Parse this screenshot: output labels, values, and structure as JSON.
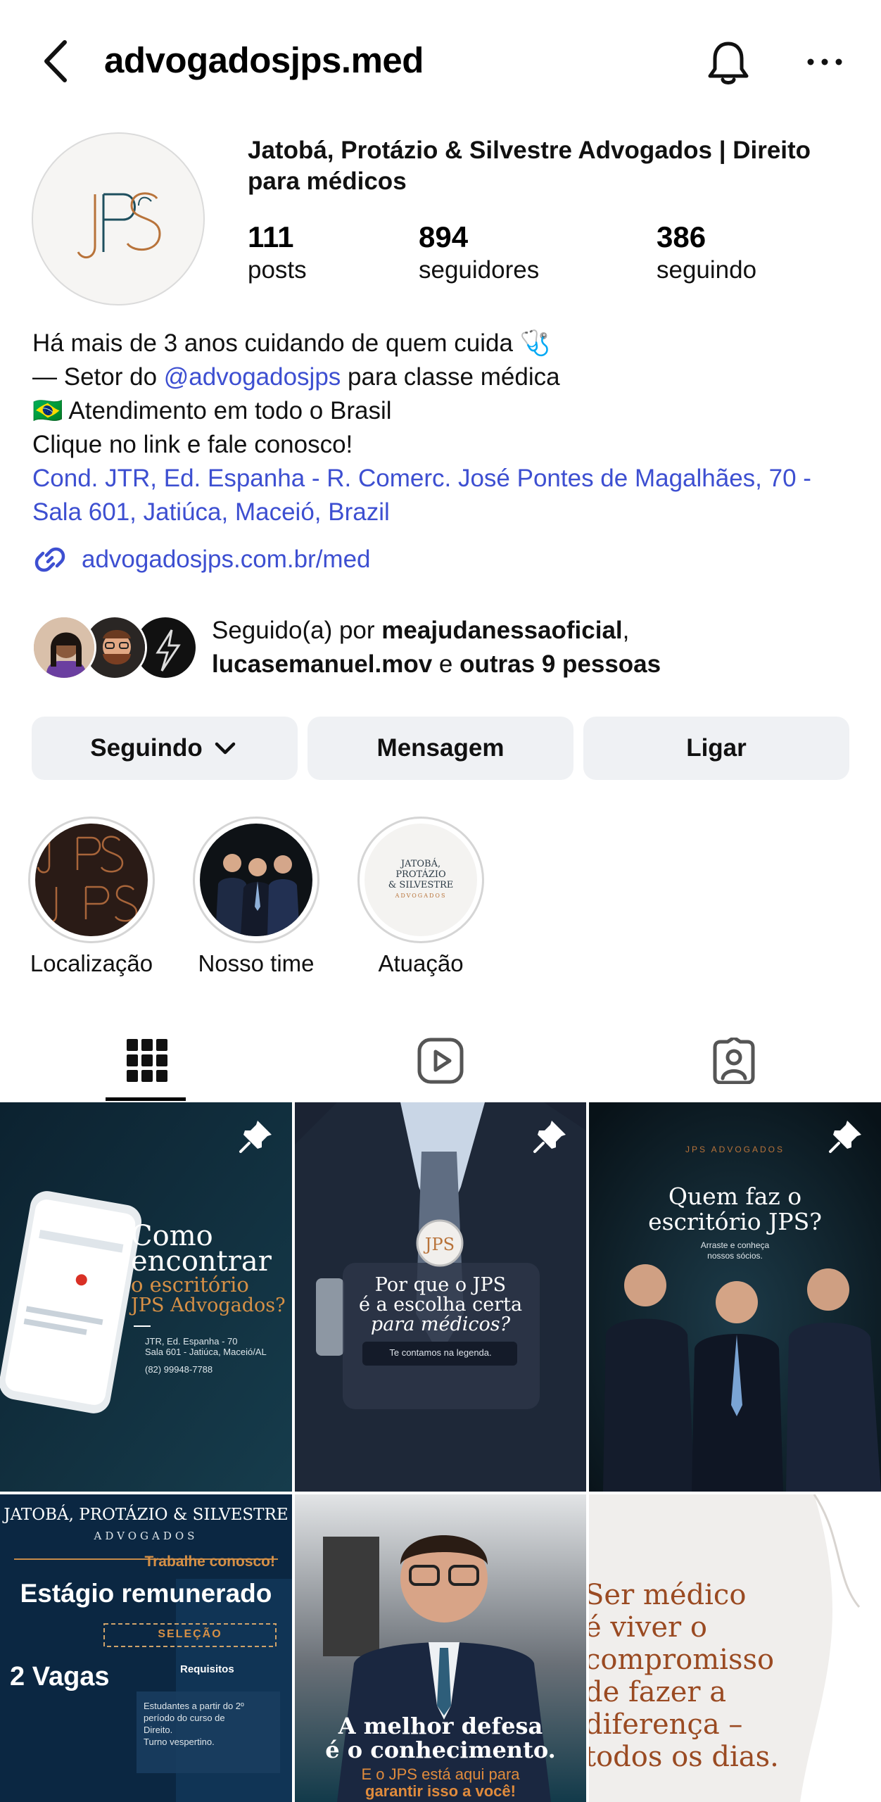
{
  "header": {
    "username": "advogadosjps.med",
    "back_icon": "chevron-left-icon",
    "bell_icon": "bell-icon",
    "more_icon": "more-horizontal-icon"
  },
  "profile": {
    "avatar_text": "JPS",
    "name": "Jatobá, Protázio & Silvestre Advogados | Direito para médicos",
    "stats": [
      {
        "value": "111",
        "label": "posts"
      },
      {
        "value": "894",
        "label": "seguidores"
      },
      {
        "value": "386",
        "label": "seguindo"
      }
    ],
    "bio": {
      "line1": "Há mais de 3 anos cuidando de quem cuida 🩺",
      "line2_prefix": "— Setor do ",
      "line2_mention": "@advogadosjps",
      "line2_suffix": " para classe médica",
      "line3": "🇧🇷 Atendimento em todo o Brasil",
      "line4": "Clique no link e fale conosco!",
      "address": "Cond. JTR, Ed. Espanha - R. Comerc. José Pontes de Magalhães, 70 - Sala 601, Jatiúca, Maceió, Brazil"
    },
    "link": "advogadosjps.com.br/med",
    "followed_by": {
      "prefix": "Seguido(a) por ",
      "user1": "meajudanessaoficial",
      "sep": ",",
      "user2": "lucasemanuel.mov",
      "conj": " e ",
      "others": "outras 9 pessoas"
    }
  },
  "actions": {
    "following": "Seguindo",
    "message": "Mensagem",
    "call": "Ligar"
  },
  "highlights": [
    {
      "label": "Localização"
    },
    {
      "label": "Nosso time"
    },
    {
      "label": "Atuação",
      "logo_lines": [
        "JATOBÁ,",
        "PROTÁZIO",
        "& SILVESTRE",
        "ADVOGADOS"
      ]
    }
  ],
  "tabs": [
    "grid-icon",
    "reels-icon",
    "tagged-icon"
  ],
  "posts": {
    "p1": {
      "title_a": "Como",
      "title_b": "encontrar",
      "title_c": "o escritório",
      "title_d": "JPS Advogados?",
      "addr_a": "JTR, Ed. Espanha - 70",
      "addr_b": "Sala 601 - Jatiúca, Maceió/AL",
      "phone": "(82) 99948-7788"
    },
    "p2": {
      "q_a": "Por que o JPS",
      "q_b": "é a escolha certa",
      "q_c": "para médicos?",
      "cta": "Te contamos na legenda."
    },
    "p3": {
      "brand": "JPS ADVOGADOS",
      "title_a": "Quem faz o",
      "title_b": "escritório JPS?",
      "sub_a": "Arraste e conheça",
      "sub_b": "nossos sócios."
    },
    "p4": {
      "firm": "JATOBÁ, PROTÁZIO & SILVESTRE",
      "adv": "ADVOGADOS",
      "call": "Trabalhe conosco!",
      "title": "Estágio remunerado",
      "badge": "SELEÇÃO",
      "vagas": "2 Vagas",
      "req": "Requisitos",
      "req_a": "Estudantes a partir do 2º",
      "req_b": "período do curso de",
      "req_c": "Direito.",
      "req_d": "Turno vespertino."
    },
    "p5": {
      "title_a": "A melhor defesa",
      "title_b": "é o conhecimento.",
      "sub_a": "E o JPS está aqui para",
      "sub_b": "garantir isso a você!"
    },
    "p6": {
      "l1": "Ser médico",
      "l2": "é viver o",
      "l3": "compromisso",
      "l4": "de fazer a",
      "l5": "diferença –",
      "l6": "todos os dias."
    }
  }
}
